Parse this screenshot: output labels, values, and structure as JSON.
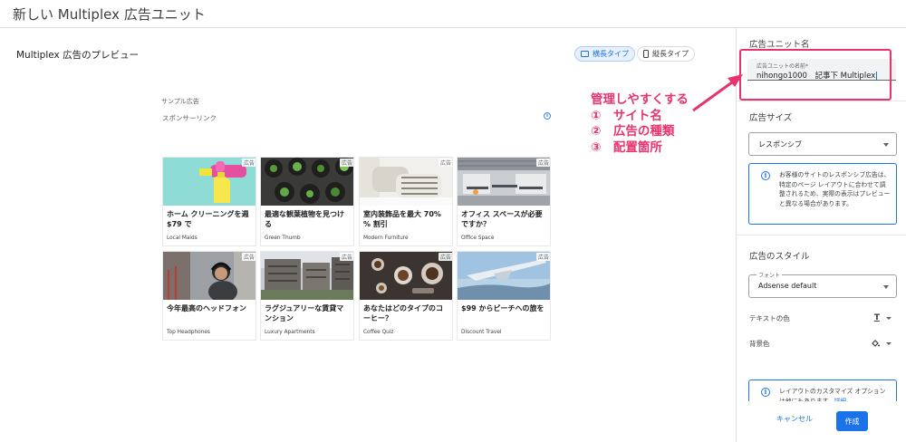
{
  "header": {
    "title": "新しい Multiplex 広告ユニット"
  },
  "preview": {
    "title": "Multiplex 広告のプレビュー",
    "toggles": [
      {
        "label": "横長タイプ",
        "selected": true
      },
      {
        "label": "縦長タイプ",
        "selected": false
      }
    ],
    "sample_label": "サンプル広告",
    "sponsored_label": "スポンサーリンク",
    "info_symbol": "i",
    "ads": [
      {
        "badge": "広告",
        "headline": "ホーム クリーニングを週 $79 で",
        "brand": "Local Maids"
      },
      {
        "badge": "広告",
        "headline": "最適な観葉植物を見つける",
        "brand": "Green Thumb"
      },
      {
        "badge": "広告",
        "headline": "室内装飾品を最大 70% % 割引",
        "brand": "Modern Furniture"
      },
      {
        "badge": "広告",
        "headline": "オフィス スペースが必要ですか？",
        "brand": "Office Space"
      },
      {
        "badge": "広告",
        "headline": "今年最高のヘッドフォン",
        "brand": "Top Headphones"
      },
      {
        "badge": "広告",
        "headline": "ラグジュアリーな賃貸マンション",
        "brand": "Luxury Apartments"
      },
      {
        "badge": "広告",
        "headline": "あなたはどのタイプのコーヒー？",
        "brand": "Coffee Quiz"
      },
      {
        "badge": "広告",
        "headline": "$99 からビーチへの旅を",
        "brand": "Discount Travel"
      }
    ]
  },
  "annotation": {
    "lines": [
      "管理しやすくする",
      "①　サイト名",
      "②　広告の種類",
      "③　配置箇所"
    ],
    "color": "#e8336d"
  },
  "panel": {
    "unit_name": {
      "section_title": "広告ユニット名",
      "field_label": "広告ユニットの名前*",
      "field_value": "nihongo1000　記事下 Multiplex"
    },
    "ad_size": {
      "section_title": "広告サイズ",
      "selected": "レスポンシブ",
      "info": "お客様のサイトのレスポンシブ広告は、特定のページ レイアウトに合わせて調整されるため、実際の表示はプレビューと異なる場合があります。"
    },
    "ad_style": {
      "section_title": "広告のスタイル",
      "font_label": "フォント",
      "font_value": "Adsense default",
      "text_color_label": "テキストの色",
      "bg_color_label": "背景色",
      "info": "レイアウトのカスタマイズ オプションは他にもあります。",
      "info_link": "詳細"
    },
    "actions": {
      "cancel": "キャンセル",
      "create": "作成"
    }
  },
  "colors": {
    "accent": "#1a73e8",
    "annotation": "#e8336d"
  }
}
